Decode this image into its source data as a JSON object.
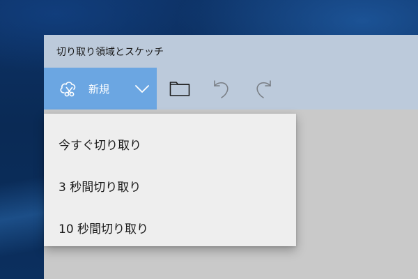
{
  "window": {
    "title": "切り取り領域とスケッチ"
  },
  "toolbar": {
    "new_label": "新規",
    "icons": {
      "new": "snip-scissors-cloud-icon",
      "dropdown": "chevron-down-icon",
      "open": "folder-icon",
      "undo": "undo-icon",
      "redo": "redo-icon"
    }
  },
  "menu": {
    "items": [
      {
        "label": "今すぐ切り取り"
      },
      {
        "label": "3 秒間切り取り"
      },
      {
        "label": "10 秒間切り取り"
      }
    ]
  },
  "colors": {
    "accent": "#6ba6e2",
    "titlebar": "#bccadb",
    "menu_bg": "#eeeeee",
    "canvas": "#c9c9c9"
  }
}
